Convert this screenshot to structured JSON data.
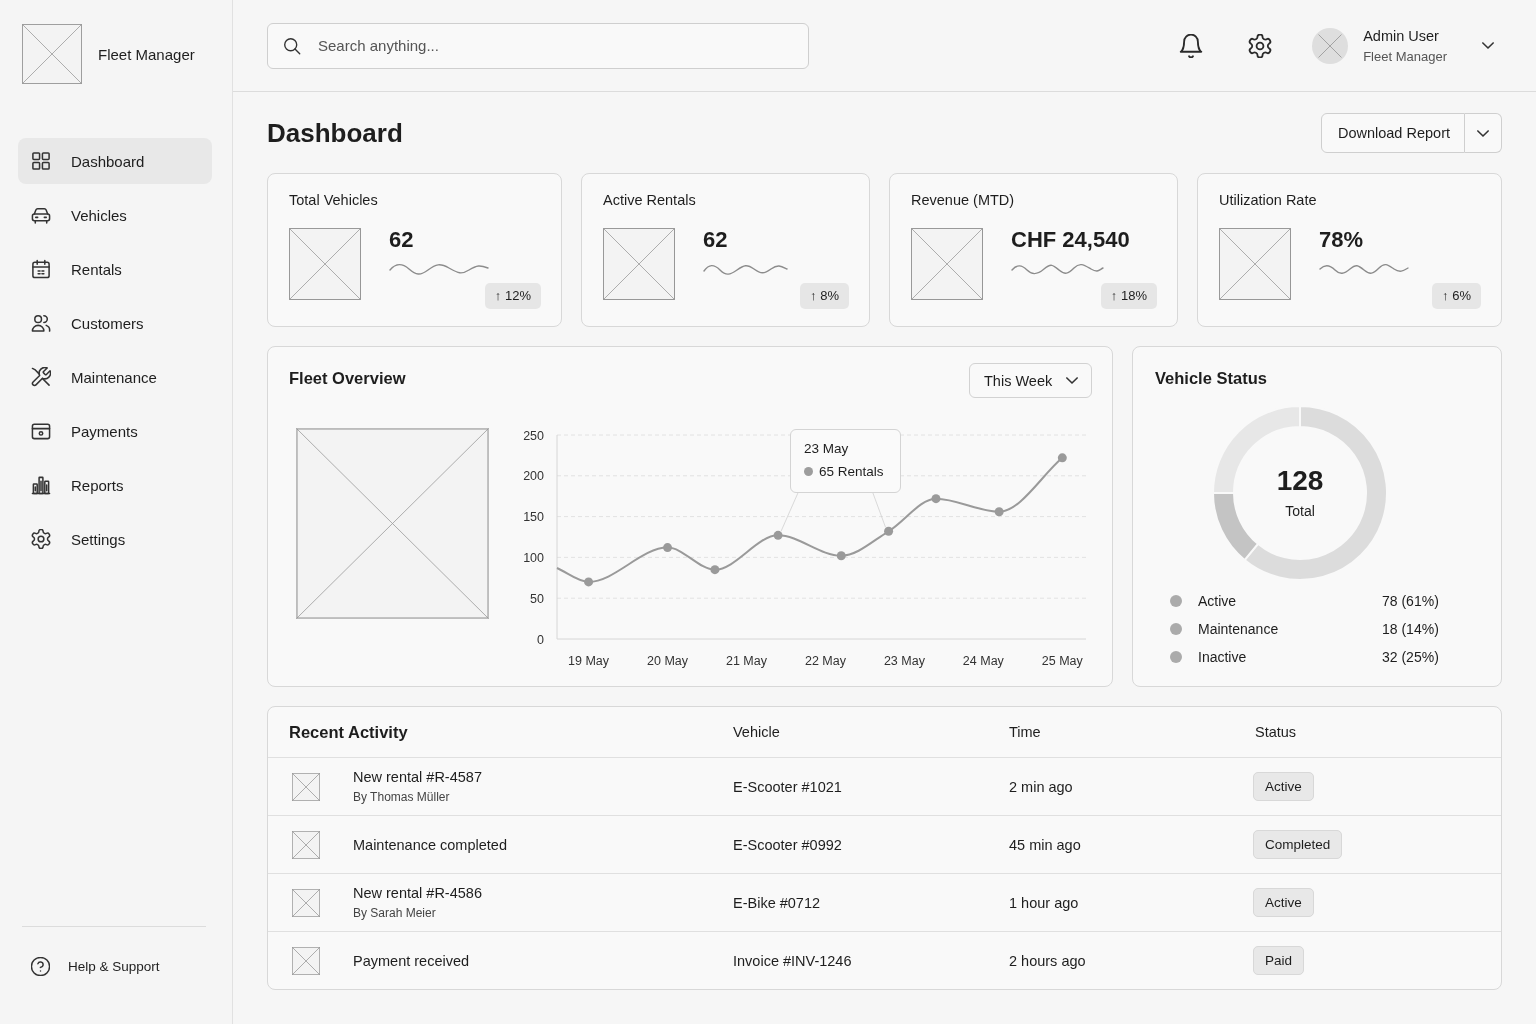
{
  "sidebar": {
    "brand": "Fleet Manager",
    "nav_items": [
      {
        "label": "Dashboard",
        "selected": true
      },
      {
        "label": "Vehicles",
        "selected": false
      },
      {
        "label": "Rentals",
        "selected": false
      },
      {
        "label": "Customers",
        "selected": false
      },
      {
        "label": "Maintenance",
        "selected": false
      },
      {
        "label": "Payments",
        "selected": false
      },
      {
        "label": "Reports",
        "selected": false
      },
      {
        "label": "Settings",
        "selected": false
      }
    ],
    "help_link": "Help & Support"
  },
  "header": {
    "search": {
      "placeholder": "Search anything..."
    },
    "user": {
      "name": "Admin User",
      "role": "Fleet Manager"
    }
  },
  "page": {
    "title": "Dashboard",
    "download_button": "Download Report"
  },
  "kpi_cards": [
    {
      "label": "Total Vehicles",
      "value": "62",
      "change": "↑ 12%"
    },
    {
      "label": "Active Rentals",
      "value": "62",
      "change": "↑ 8%"
    },
    {
      "label": "Revenue (MTD)",
      "value": "CHF 24,540",
      "change": "↑ 18%"
    },
    {
      "label": "Utilization Rate",
      "value": "78%",
      "change": "↑ 6%"
    }
  ],
  "fleet_overview": {
    "title": "Fleet Overview",
    "period": "This Week",
    "tooltip": {
      "date": "23 May",
      "value": "65 Rentals"
    },
    "chart_data": {
      "type": "line",
      "grid": true,
      "categories": [
        null,
        null,
        "19 May",
        null,
        null,
        null,
        null,
        "20 May",
        null,
        null,
        null,
        null,
        "21 May",
        null,
        null,
        null,
        null,
        "22 May",
        null,
        null,
        null,
        null,
        "23 May",
        null,
        null,
        null,
        null,
        "24 May",
        null,
        null,
        null,
        null,
        "25 May",
        null
      ],
      "series": [
        {
          "color": "#9a9a9a",
          "marker": "o",
          "values": [
            87,
            null,
            70,
            null,
            null,
            null,
            null,
            112,
            null,
            null,
            85,
            null,
            null,
            null,
            127,
            null,
            null,
            null,
            102,
            null,
            null,
            132,
            null,
            null,
            172,
            null,
            null,
            null,
            156,
            null,
            null,
            null,
            222,
            null
          ]
        }
      ],
      "ylim": [
        0,
        250
      ],
      "yticks": [
        0,
        50,
        100,
        150,
        200,
        250
      ]
    }
  },
  "vehicle_status": {
    "title": "Vehicle Status",
    "total": "128",
    "total_label": "Total",
    "chart_data": {
      "type": "donut",
      "categories": [
        "Active",
        "Maintenance",
        "Inactive"
      ],
      "values": [
        61,
        14,
        25
      ]
    },
    "readings": [
      "78 (61%)",
      "18 (14%)",
      "32 (25%)"
    ]
  },
  "recent_activity": {
    "title": "Recent Activity",
    "columns": [
      "Vehicle",
      "Time",
      "Status"
    ],
    "rows": [
      {
        "event": "New rental #R-4587",
        "by": "By Thomas Müller",
        "vehicle": "E-Scooter #1021",
        "time": "2 min ago",
        "status": "Active"
      },
      {
        "event": "Maintenance completed",
        "vehicle": "E-Scooter #0992",
        "time": "45 min ago",
        "status": "Completed"
      },
      {
        "event": "New rental #R-4586",
        "by": "By Sarah Meier",
        "vehicle": "E-Bike #0712",
        "time": "1 hour ago",
        "status": "Active"
      },
      {
        "event": "Payment received",
        "vehicle": "Invoice #INV-1246",
        "time": "2 hours ago",
        "status": "Paid"
      }
    ]
  }
}
